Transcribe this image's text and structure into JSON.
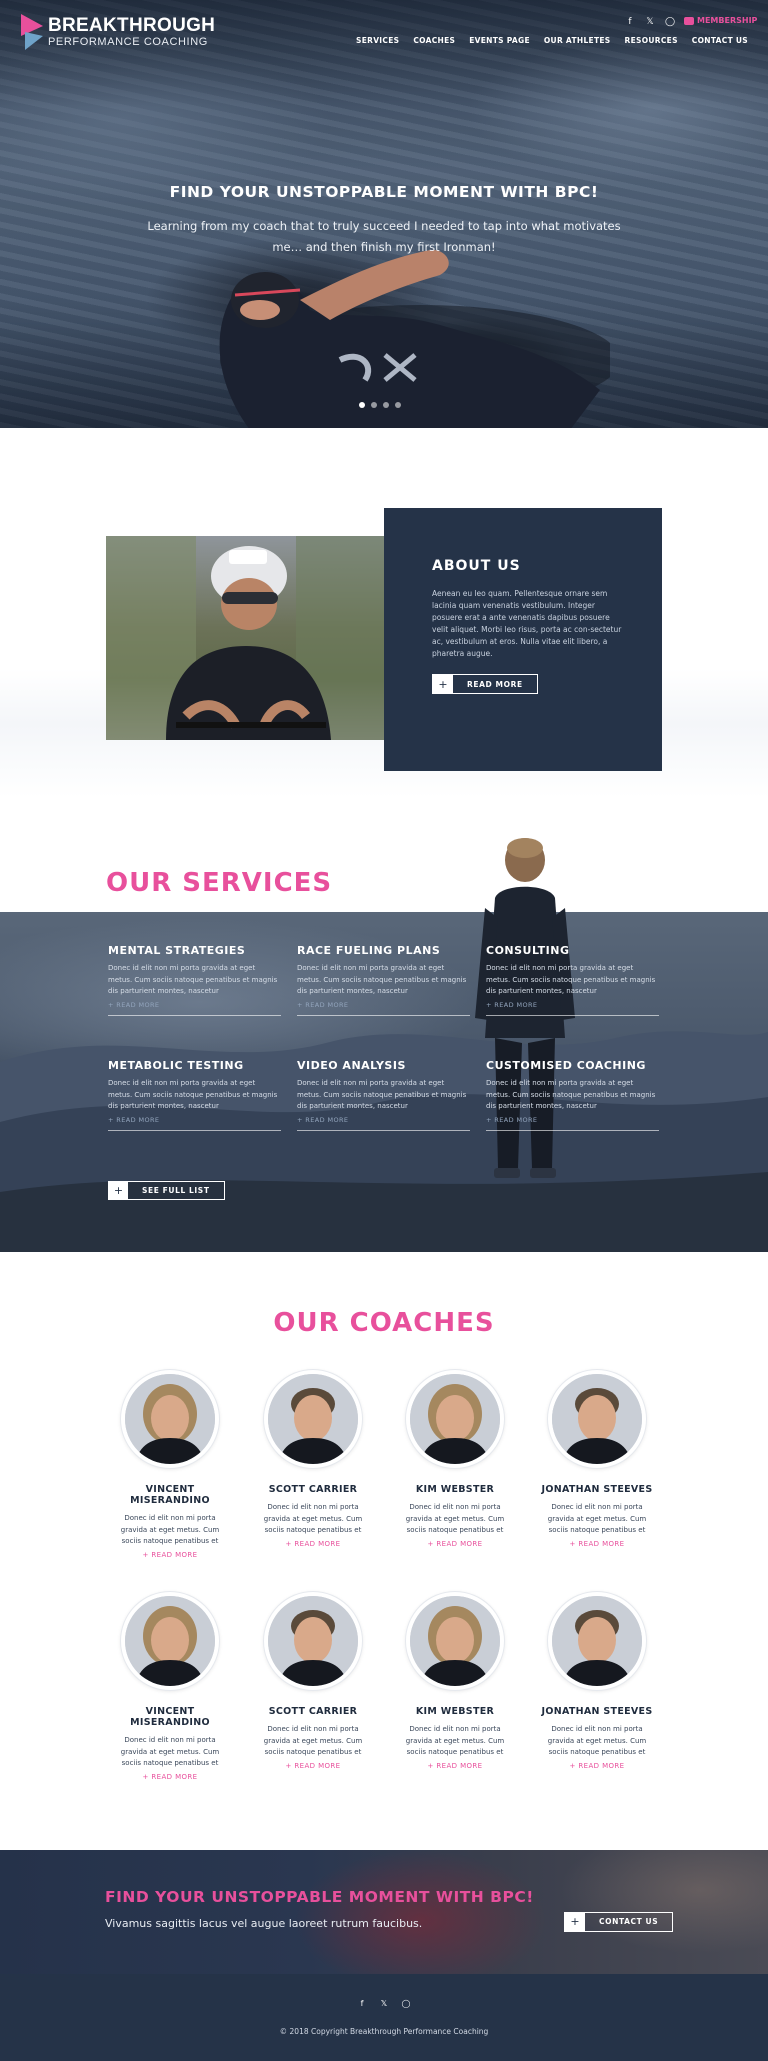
{
  "brand": {
    "name_line1": "BREAKTHROUGH",
    "name_line2": "PERFORMANCE COACHING",
    "accent": "#e8509c",
    "navy": "#253348"
  },
  "header": {
    "social_icons": [
      "facebook-icon",
      "twitter-icon",
      "instagram-icon"
    ],
    "membership_label": "MEMBERSHIP",
    "nav": [
      "SERVICES",
      "COACHES",
      "EVENTS PAGE",
      "OUR ATHLETES",
      "RESOURCES",
      "CONTACT US"
    ]
  },
  "hero": {
    "title": "FIND YOUR UNSTOPPABLE MOMENT WITH BPC!",
    "subtitle": "Learning from my coach that to truly succeed I needed to tap into what motivates me… and then finish my first Ironman!",
    "slide_count": 4,
    "active_slide": 1
  },
  "about": {
    "title": "ABOUT US",
    "text": "Aenean eu leo quam. Pellentesque ornare sem lacinia quam venenatis vestibulum. Integer posuere erat a ante venenatis dapibus posuere velit aliquet. Morbi leo risus, porta ac con-sectetur ac, vestibulum at eros. Nulla vitae elit libero, a pharetra augue.",
    "button_icon": "+",
    "button_label": "READ MORE"
  },
  "services": {
    "title": "OUR SERVICES",
    "items": [
      {
        "title": "MENTAL STRATEGIES",
        "text": "Donec id elit non mi porta gravida at eget metus. Cum sociis natoque penatibus et magnis dis parturient montes, nascetur",
        "more": "+ READ MORE"
      },
      {
        "title": "RACE FUELING PLANS",
        "text": "Donec id elit non mi porta gravida at eget metus. Cum sociis natoque penatibus et magnis dis parturient montes, nascetur",
        "more": "+ READ MORE"
      },
      {
        "title": "CONSULTING",
        "text": "Donec id elit non mi porta gravida at eget metus. Cum sociis natoque penatibus et magnis dis parturient montes, nascetur",
        "more": "+ READ MORE"
      },
      {
        "title": "METABOLIC TESTING",
        "text": "Donec id elit non mi porta gravida at eget metus. Cum sociis natoque penatibus et magnis dis parturient montes, nascetur",
        "more": "+ READ MORE"
      },
      {
        "title": "VIDEO ANALYSIS",
        "text": "Donec id elit non mi porta gravida at eget metus. Cum sociis natoque penatibus et magnis dis parturient montes, nascetur",
        "more": "+ READ MORE"
      },
      {
        "title": "CUSTOMISED COACHING",
        "text": "Donec id elit non mi porta gravida at eget metus. Cum sociis natoque penatibus et magnis dis parturient montes, nascetur",
        "more": "+ READ MORE"
      }
    ],
    "button_icon": "+",
    "button_label": "SEE FULL LIST"
  },
  "coaches": {
    "title": "OUR COACHES",
    "items": [
      {
        "name": "VINCENT MISERANDINO",
        "text": "Donec id elit non mi porta gravida at eget metus. Cum sociis natoque penatibus et",
        "more": "+ READ MORE"
      },
      {
        "name": "SCOTT CARRIER",
        "text": "Donec id elit non mi porta gravida at eget metus. Cum sociis natoque penatibus et",
        "more": "+ READ MORE"
      },
      {
        "name": "KIM WEBSTER",
        "text": "Donec id elit non mi porta gravida at eget metus. Cum sociis natoque penatibus et",
        "more": "+ READ MORE"
      },
      {
        "name": "JONATHAN STEEVES",
        "text": "Donec id elit non mi porta gravida at eget metus. Cum sociis natoque penatibus et",
        "more": "+ READ MORE"
      },
      {
        "name": "VINCENT MISERANDINO",
        "text": "Donec id elit non mi porta gravida at eget metus. Cum sociis natoque penatibus et",
        "more": "+ READ MORE"
      },
      {
        "name": "SCOTT CARRIER",
        "text": "Donec id elit non mi porta gravida at eget metus. Cum sociis natoque penatibus et",
        "more": "+ READ MORE"
      },
      {
        "name": "KIM WEBSTER",
        "text": "Donec id elit non mi porta gravida at eget metus. Cum sociis natoque penatibus et",
        "more": "+ READ MORE"
      },
      {
        "name": "JONATHAN STEEVES",
        "text": "Donec id elit non mi porta gravida at eget metus. Cum sociis natoque penatibus et",
        "more": "+ READ MORE"
      }
    ]
  },
  "cta": {
    "title": "FIND YOUR UNSTOPPABLE MOMENT WITH BPC!",
    "subtitle": "Vivamus sagittis lacus vel augue laoreet rutrum faucibus.",
    "button_icon": "+",
    "button_label": "CONTACT US"
  },
  "footer": {
    "social_icons": [
      "facebook-icon",
      "twitter-icon",
      "instagram-icon"
    ],
    "copyright": "© 2018 Copyright Breakthrough Performance Coaching"
  }
}
